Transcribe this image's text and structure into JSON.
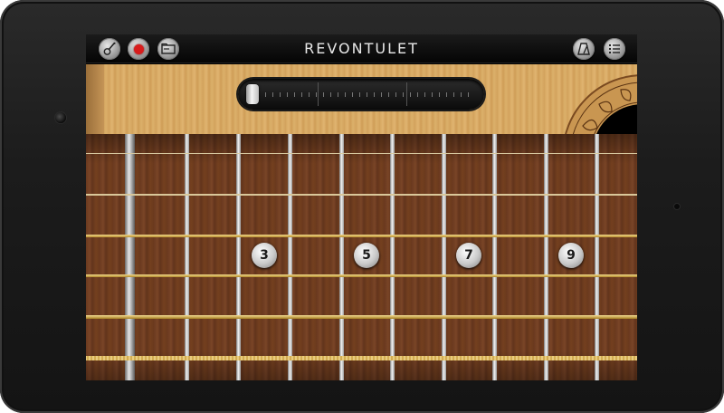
{
  "app": {
    "title": "REVONTULET"
  },
  "toolbar": {
    "left_buttons": [
      {
        "name": "guitar-icon"
      },
      {
        "name": "record-icon",
        "color": "#d81c1c"
      },
      {
        "name": "folder-icon"
      }
    ],
    "right_buttons": [
      {
        "name": "metronome-icon"
      },
      {
        "name": "menu-list-icon"
      }
    ]
  },
  "slider": {
    "value": 0
  },
  "fret_markers": [
    "3",
    "5",
    "7",
    "9"
  ],
  "colors": {
    "wood": "#d7a862",
    "fretboard": "#6b3a20",
    "record": "#d81c1c"
  }
}
